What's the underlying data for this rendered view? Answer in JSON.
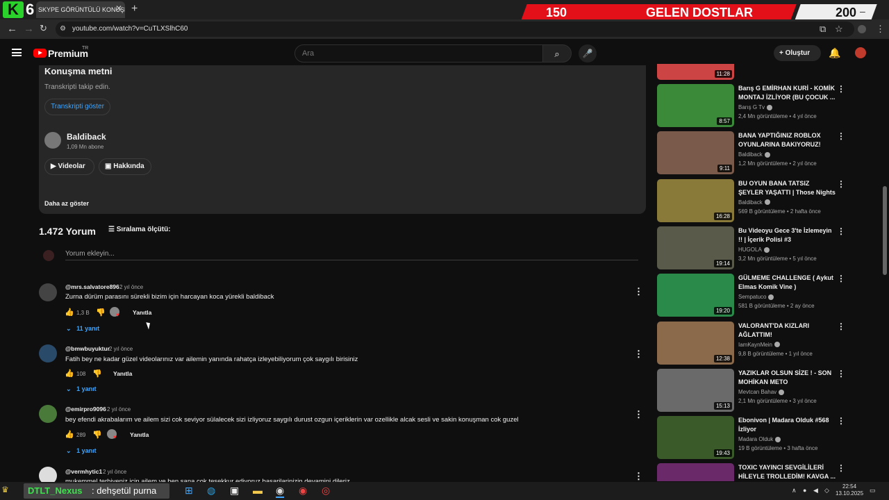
{
  "browser": {
    "logo_letter": "K",
    "badge_number": "6",
    "tab_title": "SKYPE GÖRÜNTÜLÜ KONUŞMA",
    "url": "youtube.com/watch?v=CuTLXSlhC60"
  },
  "overlay": {
    "count_left": "150",
    "label": "GELEN DOSTLAR",
    "count_right": "200"
  },
  "youtube": {
    "brand": "Premium",
    "region": "TR",
    "search_placeholder": "Ara",
    "create_label": "Oluştur"
  },
  "description": {
    "title": "Konuşma metni",
    "subtitle": "Transkripti takip edin.",
    "transcript_button": "Transkripti göster",
    "channel_name": "Baldiback",
    "channel_subs": "1,09 Mn abone",
    "videos_button": "Videolar",
    "about_button": "Hakkında",
    "show_less": "Daha az göster"
  },
  "comments": {
    "count": "1.472 Yorum",
    "sort_label": "Sıralama ölçütü:",
    "add_placeholder": "Yorum ekleyin...",
    "items": [
      {
        "user": "@mrs.salvatore896",
        "time": "2 yıl önce",
        "text": "Zurna dürüm parasını sürekli bizim için harcayan koca yürekli baldiback",
        "likes": "1,3 B",
        "reply": "Yanıtla",
        "replies": "11 yanıt"
      },
      {
        "user": "@bmwbuyuktur",
        "time": "2 yıl önce",
        "text": "Fatih bey ne kadar güzel videolarınız var ailemin yanında rahatça izleyebiliyorum çok saygılı birisiniz",
        "likes": "108",
        "reply": "Yanıtla",
        "replies": "1 yanıt"
      },
      {
        "user": "@emirpro9096",
        "time": "2 yıl önce",
        "text": "bey efendi akrabalarım ve ailem sizi cok seviyor sülalecek sizi izliyoruz saygılı durust ozgun içeriklerin var ozellikle alcak sesli ve sakin konuşman cok guzel",
        "likes": "289",
        "reply": "Yanıtla",
        "replies": "1 yanıt"
      },
      {
        "user": "@vermhytic1",
        "time": "2 yıl önce",
        "text": "mukemmel terbiyeniz için ailem ve ben sana cok tesekkur ediyoruz basarilarinizin devamini dileriz"
      }
    ]
  },
  "recommendations": [
    {
      "title": "Barış G EMİRHAN KURİ - KOMİK MONTAJ İZLİYOR (BU ÇOCUK ...",
      "channel": "Barış G Tv",
      "meta": "2,4 Mn görüntüleme • 4 yıl önce",
      "duration": "8:57",
      "color": "#3a8a3a"
    },
    {
      "title": "BANA YAPTIĞINIZ ROBLOX OYUNLARINA BAKIYORUZ!",
      "channel": "Baldiback",
      "meta": "1,2 Mn görüntüleme • 2 yıl önce",
      "duration": "9:11",
      "color": "#7a5a4a"
    },
    {
      "title": "BU OYUN BANA TATSIZ ŞEYLER YAŞATTI | Those Nights at ...",
      "channel": "Baldiback",
      "meta": "569 B görüntüleme • 2 hafta önce",
      "duration": "16:28",
      "color": "#8a7a3a"
    },
    {
      "title": "Bu Videoyu Gece 3'te İzlemeyin !! | İçerik Polisi #3",
      "channel": "HUGOLA",
      "meta": "3,2 Mn görüntüleme • 5 yıl önce",
      "duration": "19:14",
      "color": "#5a5a4a"
    },
    {
      "title": "GÜLMEME CHALLENGE ( Aykut Elmas Komik Vine )",
      "channel": "Sempatuco",
      "meta": "581 B görüntüleme • 2 ay önce",
      "duration": "19:20",
      "color": "#2a8a4a"
    },
    {
      "title": "VALORANT'DA KIZLARI AĞLATTIM!",
      "channel": "IamKaynMein",
      "meta": "9,8 B görüntüleme • 1 yıl önce",
      "duration": "12:38",
      "color": "#8a6a4a"
    },
    {
      "title": "YAZIKLAR OLSUN SİZE ! - SON MOHİKAN METO",
      "channel": "Mevtcan Bahav",
      "meta": "2,1 Mn görüntüleme • 3 yıl önce",
      "duration": "15:13",
      "color": "#6a6a6a"
    },
    {
      "title": "Ebonivon | Madara Olduk #568 İzliyor",
      "channel": "Madara Olduk",
      "meta": "19 B görüntüleme • 3 hafta önce",
      "duration": "19:43",
      "color": "#3a5a2a"
    },
    {
      "title": "TOXIC YAYINCI SEVGİLİLERİ HİLEYLE TROLLEDİM! KAVGA ...",
      "channel": "",
      "meta": "",
      "duration": "",
      "color": "#6a2a6a"
    }
  ],
  "top_thumb_duration": "11:28",
  "taskbar": {
    "chat_user": "DTLT_Nexus",
    "chat_message": ": dehşetül purna",
    "time": "22:54",
    "date": "13.10.2025"
  }
}
